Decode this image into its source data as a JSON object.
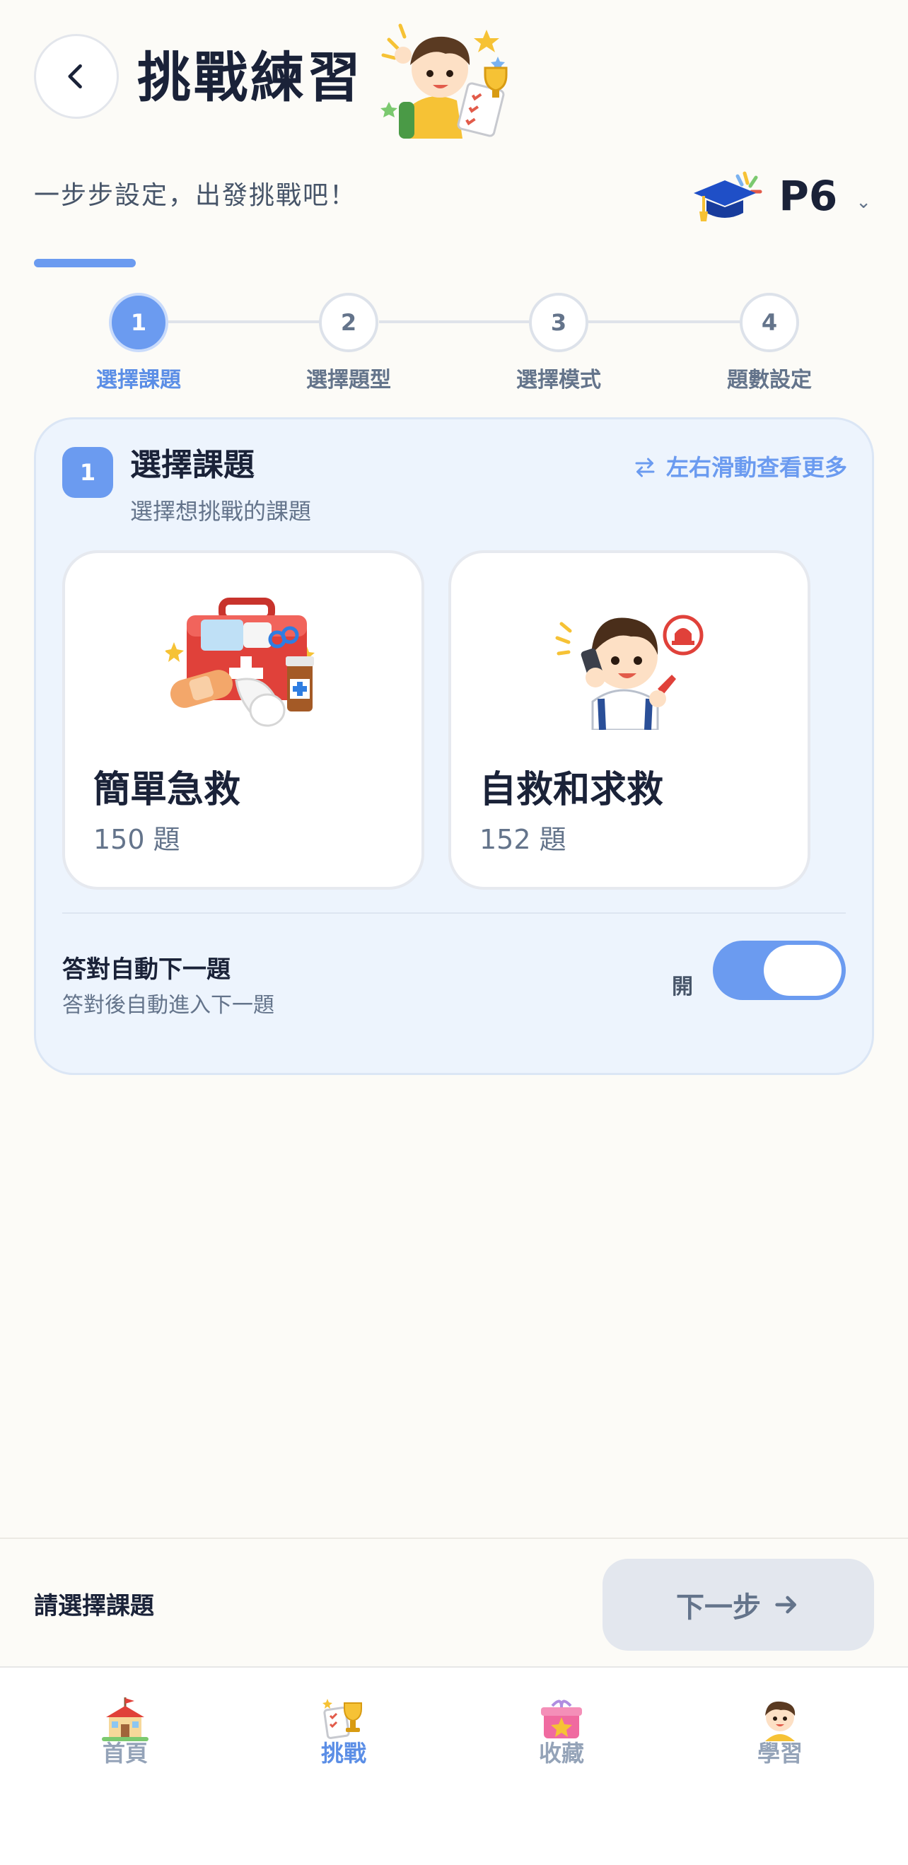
{
  "header": {
    "title": "挑戰練習",
    "subtitle": "一步步設定，出發挑戰吧！",
    "grade": "P6",
    "back_icon": "chevron-left-icon"
  },
  "progress": {
    "fraction": 0.25
  },
  "steps": [
    {
      "number": "1",
      "label": "選擇課題",
      "active": true
    },
    {
      "number": "2",
      "label": "選擇題型",
      "active": false
    },
    {
      "number": "3",
      "label": "選擇模式",
      "active": false
    },
    {
      "number": "4",
      "label": "題數設定",
      "active": false
    }
  ],
  "section": {
    "badge": "1",
    "title": "選擇課題",
    "subtitle": "選擇想挑戰的課題",
    "swipe_hint": "左右滑動查看更多"
  },
  "topics": [
    {
      "name": "簡單急救",
      "count": "150 題",
      "icon": "first-aid-kit-icon"
    },
    {
      "name": "自救和求救",
      "count": "152 題",
      "icon": "boy-calling-for-help-icon"
    }
  ],
  "auto_next": {
    "title": "答對自動下一題",
    "subtitle": "答對後自動進入下一題",
    "state_label": "開",
    "enabled": true
  },
  "action": {
    "hint": "請選擇課題",
    "next_label": "下一步"
  },
  "nav": [
    {
      "label": "首頁",
      "icon": "school-house-icon",
      "active": false
    },
    {
      "label": "挑戰",
      "icon": "trophy-checklist-icon",
      "active": true
    },
    {
      "label": "收藏",
      "icon": "gift-box-icon",
      "active": false
    },
    {
      "label": "學習",
      "icon": "student-icon",
      "active": false
    }
  ],
  "colors": {
    "accent": "#6b9bf0",
    "background": "#fcfbf7",
    "panel": "#edf4fd"
  }
}
